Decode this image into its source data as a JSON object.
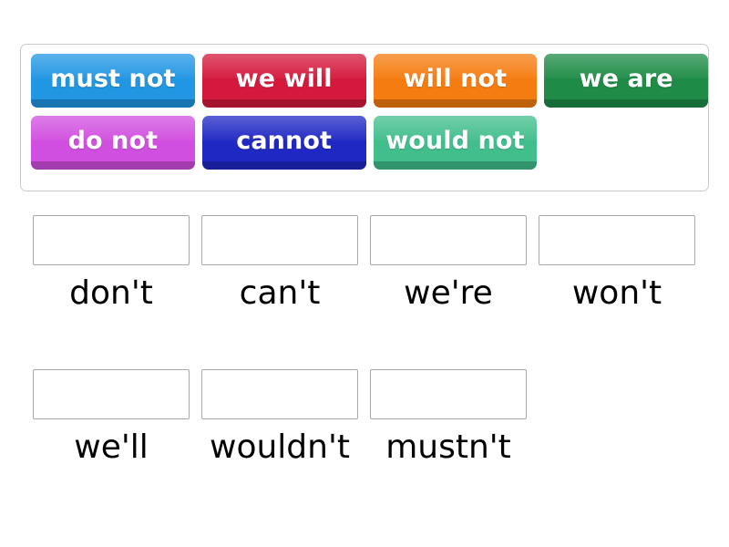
{
  "activity": {
    "type": "match-up",
    "word_bank": {
      "tiles": [
        {
          "label": "must not",
          "color": "#2196e3",
          "row": 1
        },
        {
          "label": "we will",
          "color": "#d5193c",
          "row": 1
        },
        {
          "label": "will not",
          "color": "#f57c10",
          "row": 1
        },
        {
          "label": "we are",
          "color": "#1e8c47",
          "row": 1
        },
        {
          "label": "do not",
          "color": "#d14fe0",
          "row": 2
        },
        {
          "label": "cannot",
          "color": "#2028c4",
          "row": 2
        },
        {
          "label": "would not",
          "color": "#41be8c",
          "row": 2
        }
      ]
    },
    "answer_slots": [
      {
        "label": "don't",
        "value": "",
        "row": 1
      },
      {
        "label": "can't",
        "value": "",
        "row": 1
      },
      {
        "label": "we're",
        "value": "",
        "row": 1
      },
      {
        "label": "won't",
        "value": "",
        "row": 1
      },
      {
        "label": "we'll",
        "value": "",
        "row": 2
      },
      {
        "label": "wouldn't",
        "value": "",
        "row": 2
      },
      {
        "label": "mustn't",
        "value": "",
        "row": 2
      }
    ]
  }
}
